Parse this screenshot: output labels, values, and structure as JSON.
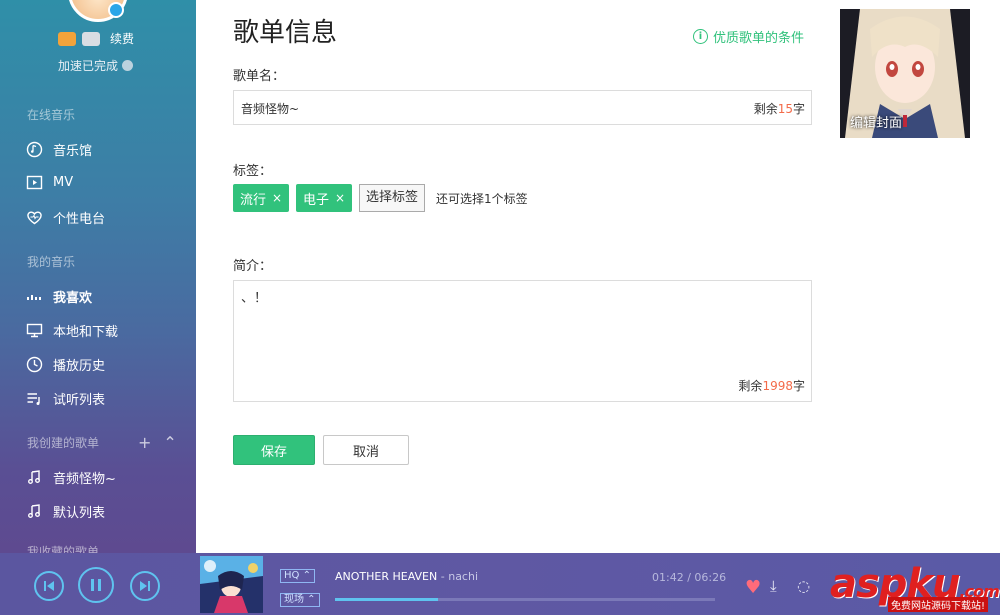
{
  "sidebar": {
    "vip_renew": "续费",
    "speed_status": "加速已完成",
    "sections": {
      "online": "在线音乐",
      "my_music": "我的音乐",
      "created": "我创建的歌单",
      "favorited": "我收藏的歌单"
    },
    "online_items": [
      {
        "label": "音乐馆",
        "icon": "music-hall-icon"
      },
      {
        "label": "MV",
        "icon": "mv-icon"
      },
      {
        "label": "个性电台",
        "icon": "radio-heart-icon"
      }
    ],
    "my_items": [
      {
        "label": "我喜欢",
        "icon": "favorites-bars-icon"
      },
      {
        "label": "本地和下载",
        "icon": "monitor-icon"
      },
      {
        "label": "播放历史",
        "icon": "clock-icon"
      },
      {
        "label": "试听列表",
        "icon": "list-icon"
      }
    ],
    "playlists": [
      {
        "label": "音频怪物~",
        "icon": "music-note-icon"
      },
      {
        "label": "默认列表",
        "icon": "music-note-icon"
      }
    ]
  },
  "main": {
    "title": "歌单信息",
    "quality_link": "优质歌单的条件",
    "name_label": "歌单名：",
    "name_value": "音频怪物~",
    "name_remain_prefix": "剩余",
    "name_remain_num": "15",
    "name_remain_suffix": "字",
    "tags_label": "标签：",
    "tags": [
      "流行",
      "电子"
    ],
    "tag_remove": "×",
    "select_tag": "选择标签",
    "tag_hint": "还可选择1个标签",
    "desc_label": "简介：",
    "desc_value": "、！",
    "desc_remain_prefix": "剩余",
    "desc_remain_num": "1998",
    "desc_remain_suffix": "字",
    "save": "保存",
    "cancel": "取消",
    "cover_label": "编辑封面"
  },
  "player": {
    "quality": "HQ",
    "mode": "现场",
    "song": "ANOTHER HEAVEN",
    "separator": " - ",
    "artist": "nachi",
    "time": "01:42 / 06:26",
    "progress": 0.27
  },
  "watermark": {
    "main": "aspku",
    "domain": ".com",
    "sub": "免费网站源码下载站!"
  },
  "colors": {
    "accent": "#31c27c",
    "remain_number": "#f36b4a",
    "progress": "#5fc3ef"
  }
}
